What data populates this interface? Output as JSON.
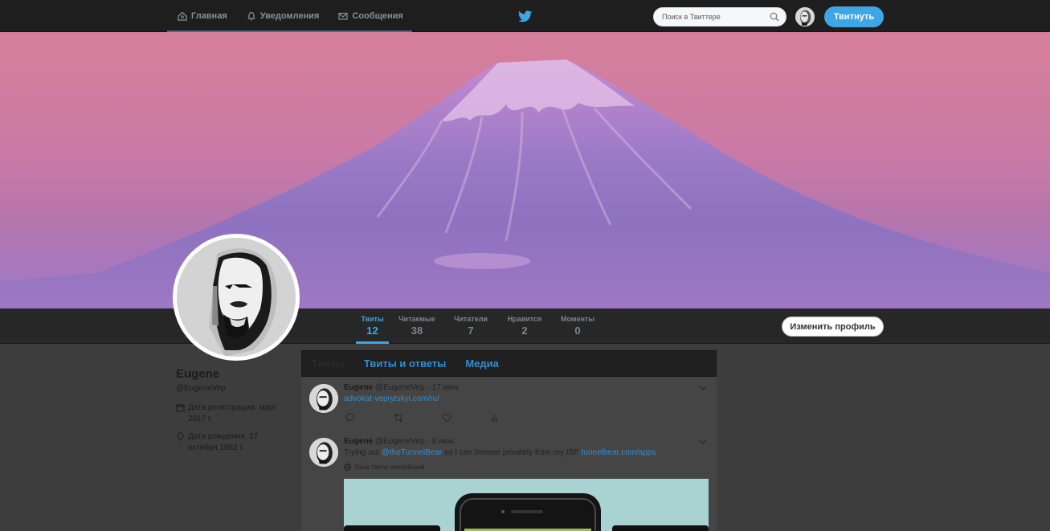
{
  "nav": {
    "items": [
      {
        "label": "Главная",
        "icon": "home-icon"
      },
      {
        "label": "Уведомления",
        "icon": "bell-icon"
      },
      {
        "label": "Сообщения",
        "icon": "envelope-icon"
      }
    ],
    "search_placeholder": "Поиск в Твиттере",
    "tweet_button": "Твитнуть"
  },
  "stats": [
    {
      "label": "Твиты",
      "value": "12"
    },
    {
      "label": "Читаемые",
      "value": "38"
    },
    {
      "label": "Читатели",
      "value": "7"
    },
    {
      "label": "Нравится",
      "value": "2"
    },
    {
      "label": "Моменты",
      "value": "0"
    }
  ],
  "edit_profile": "Изменить профиль",
  "profile": {
    "name": "Eugene",
    "handle": "@EugeneVep",
    "joined": "Дата регистрации: март 2017 г.",
    "birthday": "Дата рождения: 27 октября 1982 г."
  },
  "tabs": [
    "Твиты",
    "Твиты и ответы",
    "Медиа"
  ],
  "tweets": [
    {
      "name": "Eugene",
      "handle": "@EugeneVep",
      "time": "· 17 июн.",
      "link": "advokat-veprytskyi.com/ru/"
    },
    {
      "name": "Eugene",
      "handle": "@EugeneVep",
      "time": "· 8 июн.",
      "text_before": "Trying out ",
      "mention": "@theTunnelBear",
      "text_middle": " so I can browse privately from my ISP ",
      "link": "tunnelbear.com/apps",
      "lang": "Язык твита: английский"
    }
  ],
  "colors": {
    "accent": "#3fa6e6",
    "topbar": "#1e1e1e",
    "background": "#3d3d3d"
  }
}
